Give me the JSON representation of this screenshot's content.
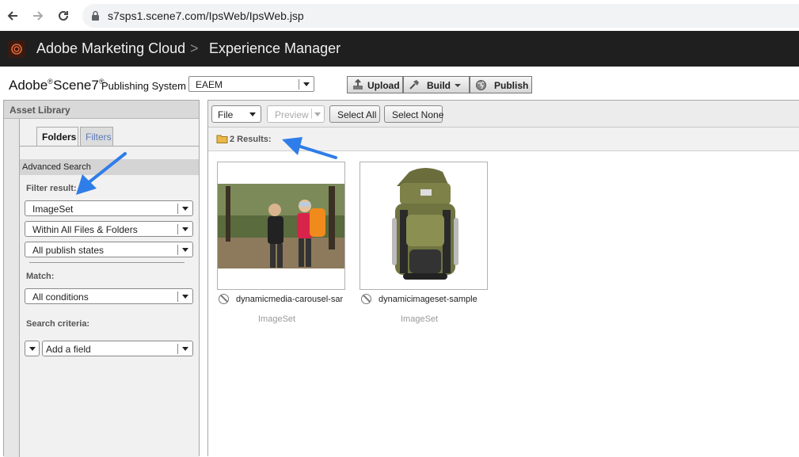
{
  "browser": {
    "url": "s7sps1.scene7.com/IpsWeb/IpsWeb.jsp"
  },
  "adobe_bar": {
    "brand": "Adobe Marketing Cloud",
    "separator": ">",
    "product": "Experience Manager"
  },
  "scene7_header": {
    "brand_adobe": "Adobe",
    "brand_scene": "Scene7",
    "subtitle": "Publishing System",
    "company_select": "EAEM",
    "buttons": {
      "upload": "Upload",
      "build": "Build",
      "publish": "Publish"
    }
  },
  "left_panel": {
    "title": "Asset Library",
    "tabs": {
      "folders": "Folders",
      "filters": "Filters"
    },
    "advanced_search": "Advanced Search",
    "filter_result_label": "Filter result:",
    "filter_type": "ImageSet",
    "filter_scope": "Within All Files & Folders",
    "filter_publish": "All publish states",
    "match_label": "Match:",
    "match_value": "All conditions",
    "search_criteria_label": "Search criteria:",
    "add_field": "Add a field"
  },
  "right_panel": {
    "toolbar": {
      "file": "File",
      "preview": "Preview",
      "select_all": "Select All",
      "select_none": "Select None"
    },
    "results_count": "2 Results:",
    "assets": [
      {
        "name": "dynamicmedia-carousel-sample",
        "type": "ImageSet"
      },
      {
        "name": "dynamicimageset-sample",
        "type": "ImageSet"
      }
    ]
  },
  "colors": {
    "adobe_bar": "#1f1f1f",
    "annotation_arrow": "#2f7de8",
    "tab_filters": "#5a7ab8"
  }
}
